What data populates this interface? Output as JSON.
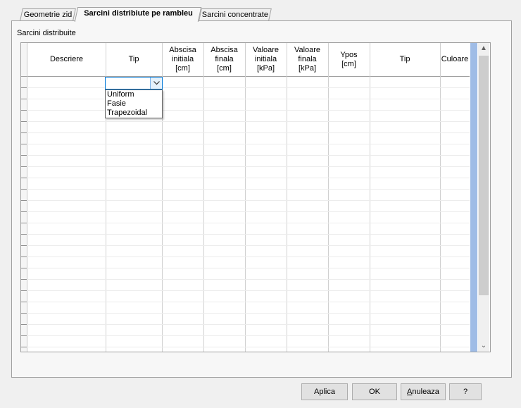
{
  "tabs": [
    {
      "label": "Geometrie zid",
      "active": false
    },
    {
      "label": "Sarcini distribiute pe rambleu",
      "active": true
    },
    {
      "label": "Sarcini concentrate",
      "active": false
    }
  ],
  "section_label": "Sarcini distribuite",
  "grid": {
    "headers": [
      "Descriere",
      "Tip",
      "Abscisa\ninitiala\n[cm]",
      "Abscisa\nfinala\n[cm]",
      "Valoare\ninitiala\n[kPa]",
      "Valoare\nfinala\n[kPa]",
      "Ypos\n[cm]",
      "Tip",
      "Culoare"
    ],
    "row_count": 24
  },
  "combo": {
    "value": "",
    "options": [
      "Uniform",
      "Fasie",
      "Trapezoidal"
    ]
  },
  "scrollbar": {
    "up_arrow": "▲",
    "down_arrow": "⌄"
  },
  "buttons": {
    "apply": "Aplica",
    "ok": "OK",
    "cancel_prefix": "A",
    "cancel_rest": "nuleaza",
    "help": "?"
  },
  "colors": {
    "selection_blue": "#0078d7",
    "scroll_highlight": "#9fbce6"
  }
}
